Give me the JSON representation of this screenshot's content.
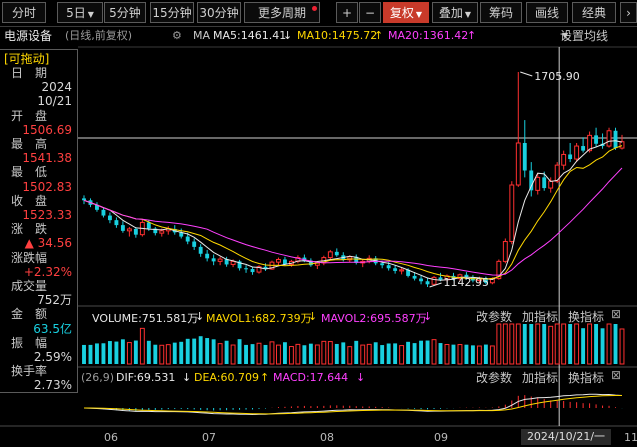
{
  "toolbar": {
    "periods": [
      "分时",
      "5日",
      "5分钟",
      "15分钟",
      "30分钟",
      "更多周期"
    ],
    "icons": [
      "plus-icon",
      "minus-icon"
    ],
    "fq": "复权",
    "overlay": "叠加",
    "chips": "筹码",
    "draw": "画线",
    "classic": "经典"
  },
  "info": {
    "name": "电源设备",
    "mode": "(日线,前复权)",
    "ma_title": "MA",
    "ma5": "MA5:1461.41",
    "ma10": "MA10:1475.72",
    "ma20": "MA20:1361.42",
    "ma_settings": "设置均线"
  },
  "sidebar": {
    "tag": "[可拖动]",
    "rows": [
      {
        "label": "日　期",
        "value": "",
        "cls": "white"
      },
      {
        "label": "",
        "value": "2024",
        "cls": "white"
      },
      {
        "label": "",
        "value": "10/21",
        "cls": "white"
      },
      {
        "label": "开　盘",
        "value": "",
        "cls": "white"
      },
      {
        "label": "",
        "value": "1506.69",
        "cls": "red"
      },
      {
        "label": "最　高",
        "value": "",
        "cls": "white"
      },
      {
        "label": "",
        "value": "1541.38",
        "cls": "red"
      },
      {
        "label": "最　低",
        "value": "",
        "cls": "white"
      },
      {
        "label": "",
        "value": "1502.83",
        "cls": "red"
      },
      {
        "label": "收　盘",
        "value": "",
        "cls": "white"
      },
      {
        "label": "",
        "value": "1523.33",
        "cls": "red"
      },
      {
        "label": "涨　跌",
        "value": "",
        "cls": "white"
      },
      {
        "label": "",
        "value": "▲ 34.56",
        "cls": "red"
      },
      {
        "label": "涨跌幅",
        "value": "",
        "cls": "white"
      },
      {
        "label": "",
        "value": "+2.32%",
        "cls": "red"
      },
      {
        "label": "成交量",
        "value": "",
        "cls": "white"
      },
      {
        "label": "",
        "value": "752万",
        "cls": "white"
      },
      {
        "label": "金　额",
        "value": "",
        "cls": "white"
      },
      {
        "label": "",
        "value": "63.5亿",
        "cls": "cyan"
      },
      {
        "label": "振　幅",
        "value": "",
        "cls": "white"
      },
      {
        "label": "",
        "value": "2.59%",
        "cls": "white"
      },
      {
        "label": "换手率",
        "value": "",
        "cls": "white"
      },
      {
        "label": "",
        "value": "2.73%",
        "cls": "white"
      }
    ]
  },
  "volume": {
    "volume": "VOLUME:751.581万",
    "mavol1": "MAVOL1:682.739万",
    "mavol2": "MAVOL2:695.587万",
    "params": "改参数",
    "add": "加指标",
    "swap": "换指标"
  },
  "macd": {
    "setup": "(26,9)",
    "dif": "DIF:69.531",
    "dea": "DEA:60.709",
    "macd": "MACD:17.644",
    "params": "改参数",
    "add": "加指标",
    "swap": "换指标"
  },
  "annotations": {
    "high": "1705.90",
    "low": "1142.95"
  },
  "x_labels": [
    "06",
    "07",
    "08",
    "09",
    "11"
  ],
  "crosshair_date": "2024/10/21/一",
  "colors": {
    "up": "#ff3030",
    "down": "#19d0e0",
    "ma5": "#e8e8e8",
    "ma10": "#ffd800",
    "ma20": "#ff40ff"
  },
  "chart_data": {
    "type": "candlestick",
    "price_range": [
      1142.95,
      1705.9
    ],
    "candles": [
      [
        1375,
        1383,
        1360,
        1370
      ],
      [
        1370,
        1375,
        1352,
        1358
      ],
      [
        1358,
        1365,
        1340,
        1345
      ],
      [
        1345,
        1350,
        1325,
        1330
      ],
      [
        1330,
        1338,
        1310,
        1318
      ],
      [
        1318,
        1325,
        1298,
        1305
      ],
      [
        1305,
        1315,
        1285,
        1290
      ],
      [
        1290,
        1300,
        1275,
        1295
      ],
      [
        1295,
        1300,
        1272,
        1280
      ],
      [
        1280,
        1320,
        1275,
        1312
      ],
      [
        1312,
        1318,
        1290,
        1296
      ],
      [
        1296,
        1300,
        1278,
        1284
      ],
      [
        1284,
        1296,
        1275,
        1290
      ],
      [
        1290,
        1302,
        1280,
        1295
      ],
      [
        1295,
        1305,
        1280,
        1286
      ],
      [
        1286,
        1296,
        1270,
        1275
      ],
      [
        1275,
        1285,
        1255,
        1262
      ],
      [
        1262,
        1270,
        1240,
        1248
      ],
      [
        1248,
        1255,
        1222,
        1230
      ],
      [
        1230,
        1240,
        1210,
        1218
      ],
      [
        1218,
        1228,
        1200,
        1210
      ],
      [
        1210,
        1222,
        1200,
        1216
      ],
      [
        1216,
        1222,
        1196,
        1202
      ],
      [
        1202,
        1215,
        1195,
        1210
      ],
      [
        1210,
        1214,
        1186,
        1192
      ],
      [
        1192,
        1200,
        1180,
        1190
      ],
      [
        1190,
        1196,
        1175,
        1182
      ],
      [
        1182,
        1200,
        1178,
        1196
      ],
      [
        1196,
        1205,
        1185,
        1190
      ],
      [
        1190,
        1212,
        1188,
        1208
      ],
      [
        1208,
        1220,
        1200,
        1215
      ],
      [
        1215,
        1222,
        1198,
        1202
      ],
      [
        1202,
        1214,
        1196,
        1210
      ],
      [
        1210,
        1226,
        1205,
        1220
      ],
      [
        1220,
        1228,
        1208,
        1212
      ],
      [
        1212,
        1218,
        1196,
        1200
      ],
      [
        1200,
        1210,
        1190,
        1206
      ],
      [
        1206,
        1225,
        1200,
        1220
      ],
      [
        1220,
        1240,
        1215,
        1235
      ],
      [
        1235,
        1244,
        1222,
        1226
      ],
      [
        1226,
        1234,
        1210,
        1214
      ],
      [
        1214,
        1226,
        1208,
        1222
      ],
      [
        1222,
        1228,
        1202,
        1206
      ],
      [
        1206,
        1215,
        1195,
        1210
      ],
      [
        1210,
        1226,
        1205,
        1218
      ],
      [
        1218,
        1224,
        1200,
        1205
      ],
      [
        1205,
        1212,
        1192,
        1200
      ],
      [
        1200,
        1208,
        1186,
        1192
      ],
      [
        1192,
        1200,
        1178,
        1185
      ],
      [
        1185,
        1195,
        1176,
        1188
      ],
      [
        1188,
        1192,
        1168,
        1172
      ],
      [
        1172,
        1182,
        1160,
        1165
      ],
      [
        1165,
        1175,
        1150,
        1158
      ],
      [
        1158,
        1168,
        1142.95,
        1150
      ],
      [
        1150,
        1172,
        1146,
        1168
      ],
      [
        1168,
        1180,
        1158,
        1162
      ],
      [
        1162,
        1176,
        1156,
        1172
      ],
      [
        1172,
        1180,
        1160,
        1165
      ],
      [
        1165,
        1178,
        1158,
        1175
      ],
      [
        1175,
        1182,
        1162,
        1168
      ],
      [
        1168,
        1174,
        1155,
        1160
      ],
      [
        1160,
        1170,
        1152,
        1166
      ],
      [
        1166,
        1170,
        1150,
        1154
      ],
      [
        1154,
        1168,
        1150,
        1165
      ],
      [
        1165,
        1215,
        1162,
        1210
      ],
      [
        1210,
        1270,
        1205,
        1262
      ],
      [
        1262,
        1420,
        1255,
        1410
      ],
      [
        1410,
        1705.9,
        1405,
        1520
      ],
      [
        1520,
        1580,
        1430,
        1448
      ],
      [
        1448,
        1470,
        1380,
        1396
      ],
      [
        1396,
        1440,
        1385,
        1430
      ],
      [
        1430,
        1445,
        1395,
        1402
      ],
      [
        1402,
        1430,
        1390,
        1420
      ],
      [
        1420,
        1470,
        1415,
        1462
      ],
      [
        1462,
        1500,
        1450,
        1490
      ],
      [
        1490,
        1520,
        1470,
        1478
      ],
      [
        1478,
        1520,
        1470,
        1512
      ],
      [
        1512,
        1535,
        1495,
        1500
      ],
      [
        1500,
        1550,
        1495,
        1540
      ],
      [
        1540,
        1560,
        1510,
        1518
      ],
      [
        1518,
        1545,
        1505,
        1512
      ],
      [
        1512,
        1560,
        1508,
        1552
      ],
      [
        1552,
        1560,
        1502,
        1506.69
      ],
      [
        1506.69,
        1541.38,
        1502.83,
        1523.33
      ]
    ]
  }
}
